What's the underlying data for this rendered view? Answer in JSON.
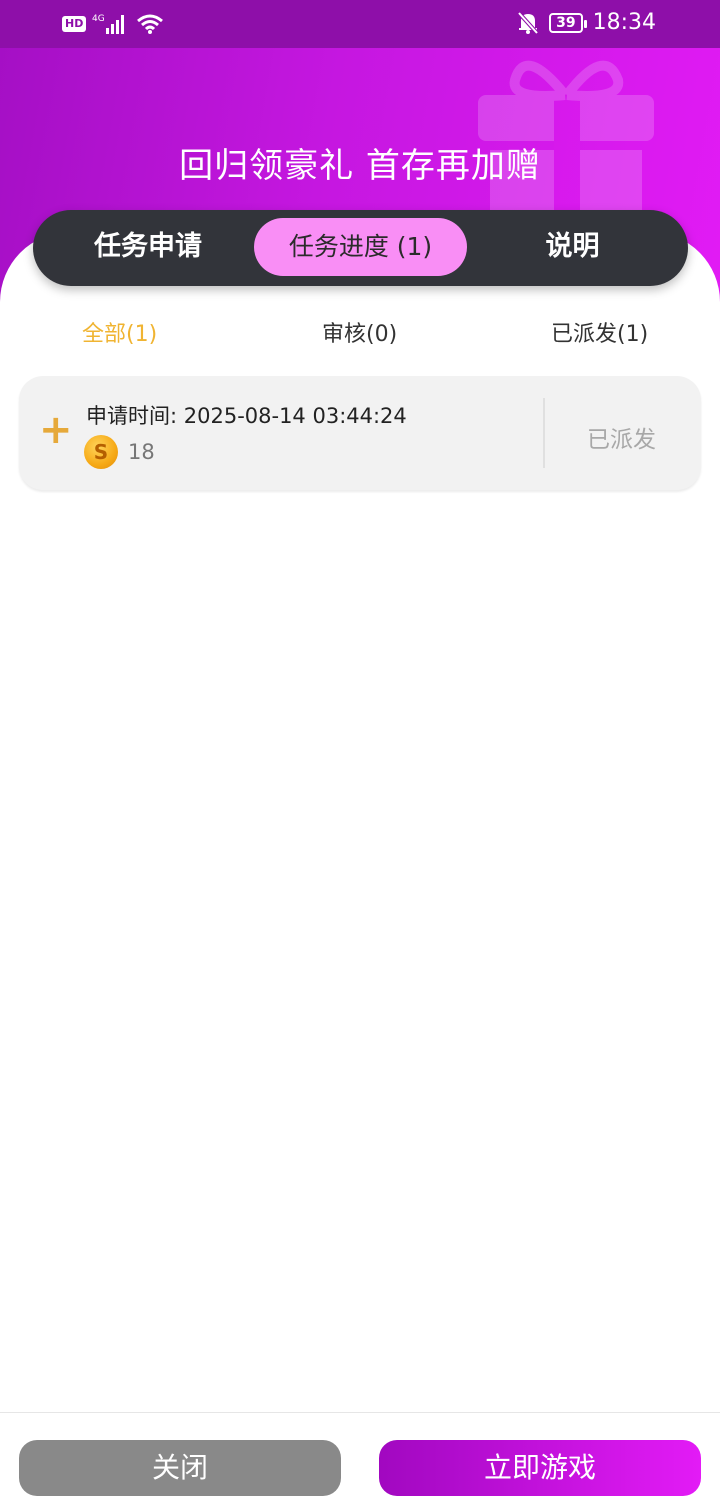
{
  "status_bar": {
    "hd": "HD",
    "network": "4G",
    "battery": "39",
    "time": "18:34",
    "icons": [
      "signal-icon",
      "wifi-icon",
      "mute-bell-icon"
    ]
  },
  "banner": {
    "title": "回归领豪礼 首存再加赠"
  },
  "tabs": [
    {
      "label": "任务申请",
      "active": false
    },
    {
      "label": "任务进度 (1)",
      "active": true
    },
    {
      "label": "说明",
      "active": false
    }
  ],
  "filters": [
    {
      "label": "全部(1)",
      "active": true
    },
    {
      "label": "审核(0)",
      "active": false
    },
    {
      "label": "已派发(1)",
      "active": false
    }
  ],
  "records": [
    {
      "time_label": "申请时间: 2025-08-14 03:44:24",
      "coin_symbol": "S",
      "amount": "18",
      "status": "已派发"
    }
  ],
  "buttons": {
    "close": "关闭",
    "play": "立即游戏"
  },
  "colors": {
    "accent": "#c517e0",
    "active_tab": "#f98ef5",
    "active_filter": "#f0b432",
    "tabs_bg": "#32343a"
  }
}
